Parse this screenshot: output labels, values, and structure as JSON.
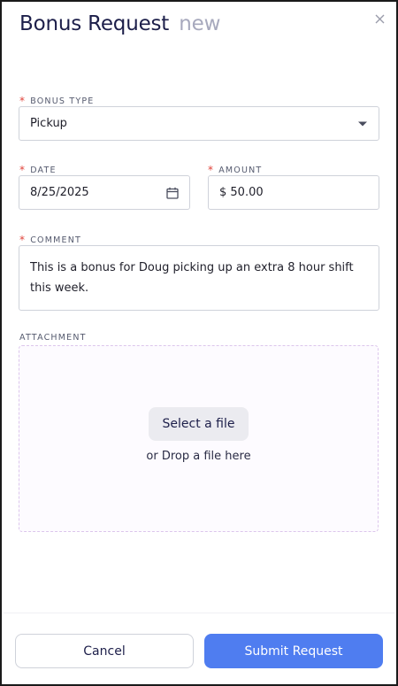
{
  "header": {
    "title": "Bonus Request",
    "status": "new"
  },
  "form": {
    "bonus_type": {
      "label": "BONUS TYPE",
      "required_mark": "*",
      "value": "Pickup"
    },
    "date": {
      "label": "DATE",
      "required_mark": "*",
      "value": "8/25/2025"
    },
    "amount": {
      "label": "AMOUNT",
      "required_mark": "*",
      "value": "$ 50.00"
    },
    "comment": {
      "label": "COMMENT",
      "required_mark": "*",
      "value": "This is a bonus for Doug picking up an extra 8 hour shift this week."
    },
    "attachment": {
      "label": "ATTACHMENT",
      "select_button": "Select a file",
      "drop_text": "or Drop a file here"
    }
  },
  "footer": {
    "cancel_label": "Cancel",
    "submit_label": "Submit Request"
  },
  "colors": {
    "primary": "#4f7df0",
    "required": "#e0433a",
    "title": "#1d1f4a",
    "status_tag": "#a7a9bd"
  },
  "icons": {
    "close": "close-icon",
    "dropdown": "chevron-down-icon",
    "calendar": "calendar-icon"
  }
}
